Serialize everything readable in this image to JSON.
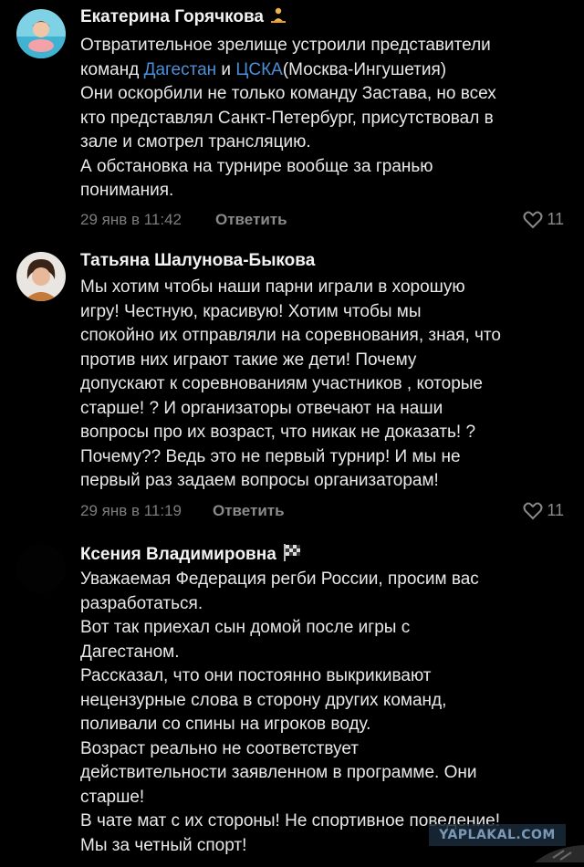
{
  "comments": [
    {
      "author": "Екатерина Горячкова",
      "emoji": "🧘",
      "lines": [
        "Отвратительное зрелище устроили представители",
        "Они оскорбили не только команду Застава, но всех",
        "кто представлял Санкт-Петербург, присутствовал в",
        "зале и смотрел трансляцию.",
        "А обстановка на турнире вообще за гранью",
        "понимания."
      ],
      "line2_prefix": "команд ",
      "link1": "Дагестан",
      "link_sep": " и  ",
      "link2": "ЦСКА",
      "line2_suffix": "(Москва-Ингушетия)",
      "date": "29 янв в 11:42",
      "reply": "Ответить",
      "likes": "11"
    },
    {
      "author": "Татьяна Шалунова-Быкова",
      "lines": [
        "Мы хотим чтобы наши парни играли в хорошую",
        "игру!  Честную, красивую! Хотим чтобы мы",
        "спокойно их отправляли на соревнования, зная, что",
        "против них играют такие же дети!  Почему",
        "допускают к соревнованиям участников , которые",
        "старше! ? И организаторы отвечают на наши",
        "вопросы про их возраст, что никак не доказать! ?",
        "Почему??  Ведь это не первый турнир! И мы не",
        "первый раз задаем вопросы организаторам!"
      ],
      "date": "29 янв в 11:19",
      "reply": "Ответить",
      "likes": "11"
    },
    {
      "author": "Ксения Владимировна",
      "emoji": "🏁",
      "lines": [
        "Уважаемая Федерация регби России, просим вас",
        "разработаться.",
        "Вот так приехал сын домой после игры с",
        "Дагестаном.",
        "Рассказал, что они постоянно выкрикивают",
        "нецензурные слова в сторону других команд,",
        "поливали со спины на игроков воду.",
        "Возраст реально не соответствует",
        "действительности заявленном в программе. Они",
        "старше!",
        "В чате мат с их стороны! Не спортивное поведение!",
        "Мы за четный спорт!"
      ]
    }
  ],
  "watermark": "YAPLAKAL.COM",
  "colors": {
    "background": "#000000",
    "link": "#4a8fd8",
    "meta": "#7d7d7d"
  },
  "icons": [
    "heart-icon"
  ]
}
